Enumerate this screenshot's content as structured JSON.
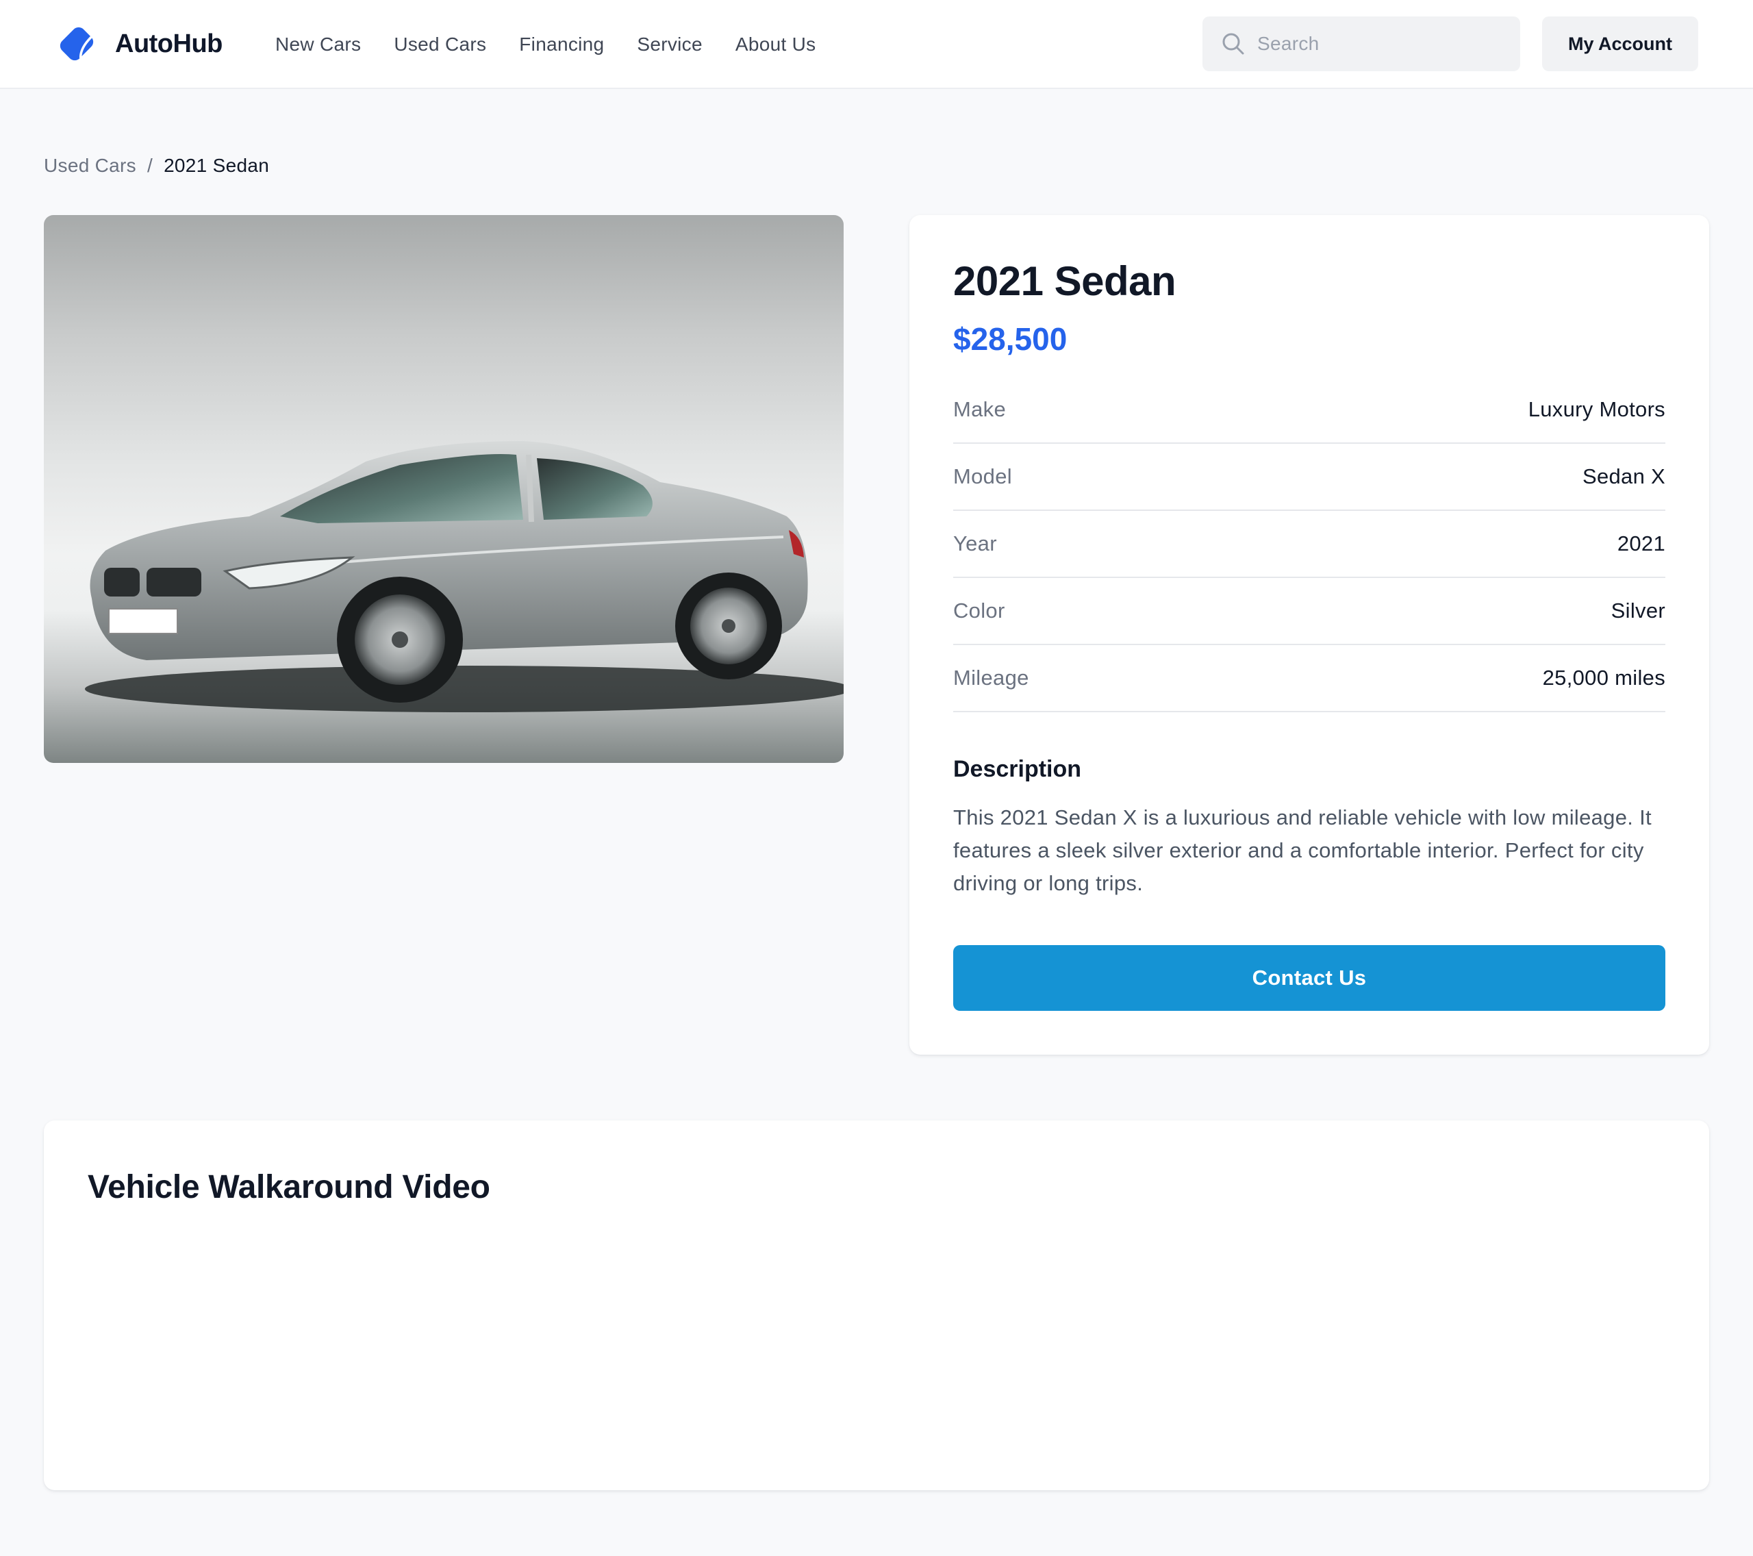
{
  "brand": {
    "name": "AutoHub",
    "logo_icon": "diamond-tag-icon",
    "accent_color": "#2563eb"
  },
  "nav": {
    "items": [
      "New Cars",
      "Used Cars",
      "Financing",
      "Service",
      "About Us"
    ]
  },
  "search": {
    "placeholder": "Search",
    "value": "",
    "icon": "search-icon"
  },
  "account": {
    "label": "My Account"
  },
  "breadcrumb": {
    "parent": "Used Cars",
    "separator": "/",
    "current": "2021 Sedan"
  },
  "vehicle": {
    "title": "2021 Sedan",
    "price": "$28,500",
    "price_color": "#2563eb",
    "specs": [
      {
        "label": "Make",
        "value": "Luxury Motors"
      },
      {
        "label": "Model",
        "value": "Sedan X"
      },
      {
        "label": "Year",
        "value": "2021"
      },
      {
        "label": "Color",
        "value": "Silver"
      },
      {
        "label": "Mileage",
        "value": "25,000 miles"
      }
    ],
    "description_heading": "Description",
    "description": "This 2021 Sedan X is a luxurious and reliable vehicle with low mileage. It features a sleek silver exterior and a comfortable interior. Perfect for city driving or long trips.",
    "contact_label": "Contact Us",
    "contact_color": "#1593d4",
    "photo_alt": "Silver sedan photo"
  },
  "video": {
    "title": "Vehicle Walkaround Video"
  }
}
